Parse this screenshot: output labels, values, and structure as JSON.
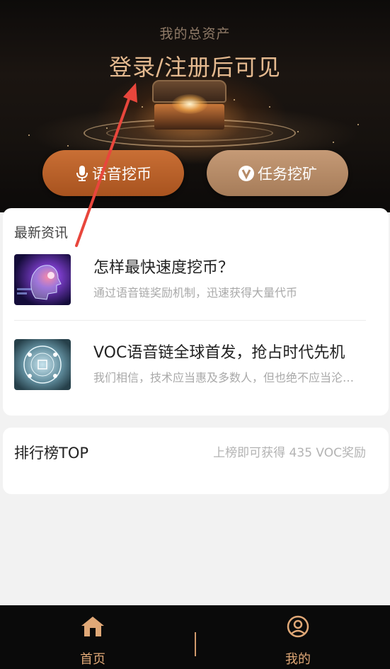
{
  "hero": {
    "label": "我的总资产",
    "value": "登录/注册后可见"
  },
  "actions": {
    "voice_mining": "语音挖币",
    "task_mining": "任务挖矿"
  },
  "news": {
    "section_title": "最新资讯",
    "items": [
      {
        "title": "怎样最快速度挖币？",
        "desc": "通过语音链奖励机制，迅速获得大量代币",
        "thumb_icon": "ai-head-thumbnail"
      },
      {
        "title": "VOC语音链全球首发，抢占时代先机",
        "desc": "我们相信，技术应当惠及多数人，但也绝不应当沦为少数人的工具",
        "thumb_icon": "tech-globe-thumbnail"
      }
    ]
  },
  "ranking": {
    "title": "排行榜TOP",
    "note": "上榜即可获得 435 VOC奖励"
  },
  "tabbar": {
    "home": "首页",
    "mine": "我的"
  },
  "colors": {
    "accent": "#e0a877",
    "voice_button": "#b85e27",
    "task_button": "#b58a66",
    "annotation_arrow": "#e8463c"
  }
}
